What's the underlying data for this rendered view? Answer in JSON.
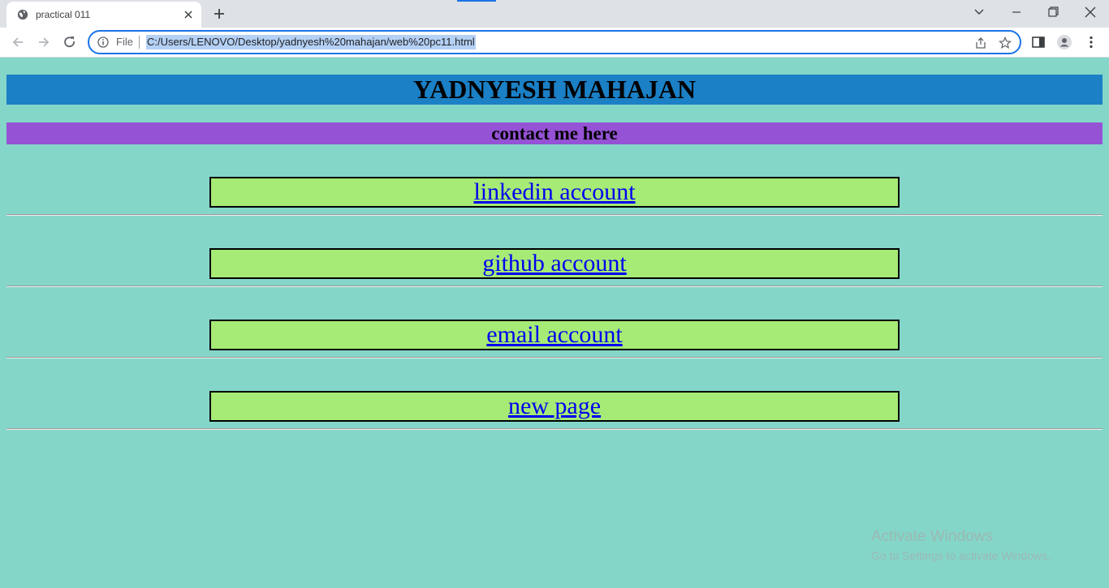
{
  "browser": {
    "tab_title": "practical 011",
    "omnibox": {
      "scheme_label": "File",
      "url": "C:/Users/LENOVO/Desktop/yadnyesh%20mahajan/web%20pc11.html"
    },
    "icons": [
      "globe-icon",
      "close-icon",
      "plus-icon",
      "chevron-down-icon",
      "minimize-icon",
      "restore-icon",
      "close-window-icon",
      "back-arrow-icon",
      "forward-arrow-icon",
      "reload-icon",
      "info-icon",
      "share-icon",
      "star-icon",
      "side-panel-icon",
      "profile-icon",
      "more-vert-icon"
    ],
    "accent_color": "#1a73e8"
  },
  "page": {
    "title": "YADNYESH MAHAJAN",
    "subtitle": "contact me here",
    "links": [
      {
        "label": "linkedin account"
      },
      {
        "label": "github account"
      },
      {
        "label": "email account"
      },
      {
        "label": "new page"
      }
    ],
    "colors": {
      "background": "#84d6c9",
      "title_bar": "#1b80c5",
      "subtitle_bar": "#9552d5",
      "link_box": "#a6eb75",
      "link_text": "#0000ee"
    }
  },
  "watermark": {
    "line1": "Activate Windows",
    "line2": "Go to Settings to activate Windows."
  }
}
